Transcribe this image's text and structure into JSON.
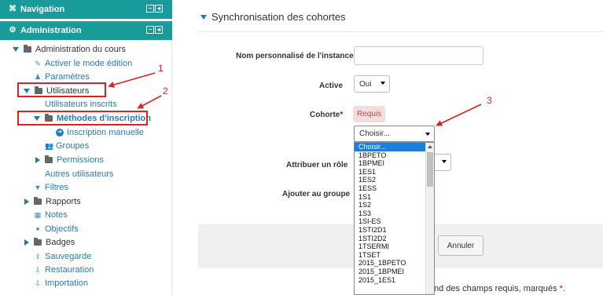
{
  "sidebar": {
    "navigation": {
      "title": "Navigation"
    },
    "administration": {
      "title": "Administration"
    },
    "items": {
      "admin_cours": "Administration du cours",
      "activer_edition": "Activer le mode édition",
      "parametres": "Paramètres",
      "utilisateurs": "Utilisateurs",
      "utilisateurs_inscrits": "Utilisateurs inscrits",
      "methodes_inscription": "Méthodes d'inscription",
      "inscription_manuelle": "Inscription manuelle",
      "groupes": "Groupes",
      "permissions": "Permissions",
      "autres_utilisateurs": "Autres utilisateurs",
      "filtres": "Filtres",
      "rapports": "Rapports",
      "notes": "Notes",
      "objectifs": "Objectifs",
      "badges": "Badges",
      "sauvegarde": "Sauvegarde",
      "restauration": "Restauration",
      "importation": "Importation"
    }
  },
  "form": {
    "section_title": "Synchronisation des cohortes",
    "labels": {
      "nom_instance": "Nom personnalisé de l'instance",
      "active": "Active",
      "cohorte": "Cohorte",
      "attribuer_role": "Attribuer un rôle",
      "ajouter_groupe": "Ajouter au groupe"
    },
    "active_value": "Oui",
    "cohorte_required": "Requis",
    "cohorte_select": "Choisir...",
    "required_mark": "*",
    "annuler": "Annuler",
    "required_note": "nd des champs requis, marqués"
  },
  "dropdown": {
    "options": [
      "Choisir...",
      "1BPETO",
      "1BPMEI",
      "1ES1",
      "1ES2",
      "1ESS",
      "1S1",
      "1S2",
      "1S3",
      "1SI-ES",
      "1STI2D1",
      "1STI2D2",
      "1TSERMI",
      "1TSET",
      "2015_1BPETO",
      "2015_1BPMEI",
      "2015_1ES1"
    ],
    "selected_index": 0
  },
  "annotations": {
    "n1": "1",
    "n2": "2",
    "n3": "3"
  },
  "colors": {
    "header_bg": "#1a9b9b",
    "link": "#2a7ab8",
    "annotation": "#e02020",
    "selected": "#1e7fd6"
  }
}
